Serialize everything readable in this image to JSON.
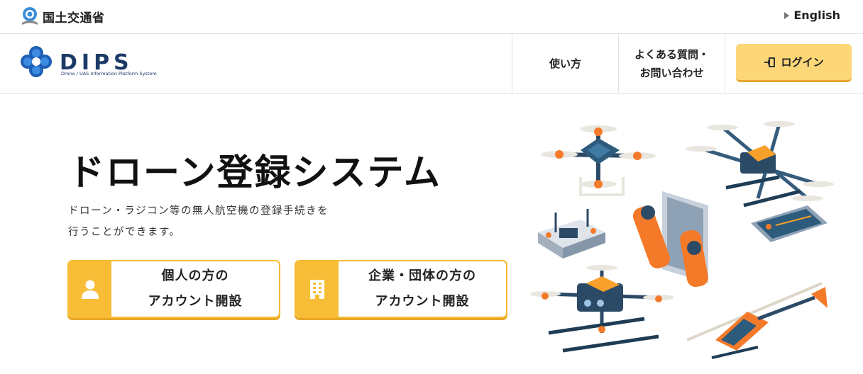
{
  "topbar": {
    "ministry_name": "国土交通省",
    "language_link": "English"
  },
  "header": {
    "logo_text": "DIPS",
    "logo_subtitle": "Drone / UAS Information Platform System",
    "nav": {
      "howto": "使い方",
      "faq_line1": "よくある質問・",
      "faq_line2": "お問い合わせ"
    },
    "login_label": "ログイン"
  },
  "hero": {
    "title": "ドローン登録システム",
    "desc_line1": "ドローン・ラジコン等の無人航空機の登録手続きを",
    "desc_line2": "行うことができます。"
  },
  "accounts": {
    "personal_line1": "個人の方の",
    "personal_line2": "アカウント開設",
    "corp_line1": "企業・団体の方の",
    "corp_line2": "アカウント開設"
  },
  "colors": {
    "accent_yellow": "#f8bd36",
    "login_yellow": "#fdd678",
    "brand_navy": "#1c3a68",
    "brand_blue": "#2a6fc0"
  }
}
